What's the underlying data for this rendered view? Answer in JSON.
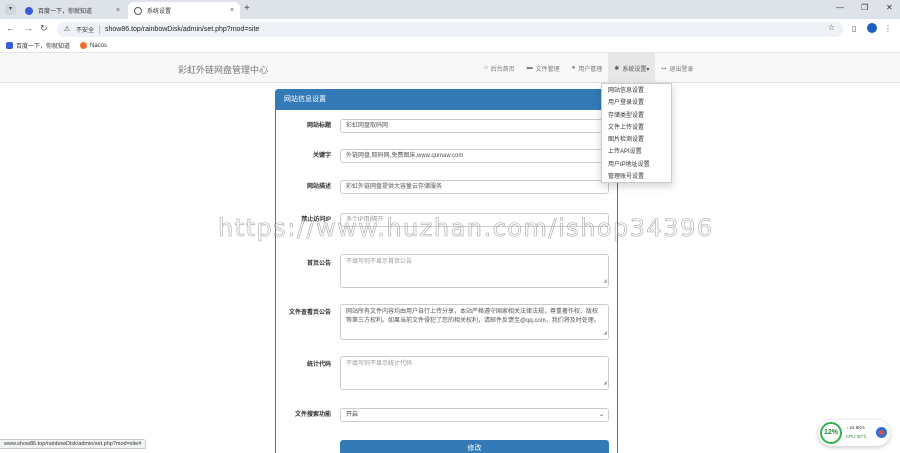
{
  "browser": {
    "tabs": [
      {
        "title": "百度一下，你就知道",
        "active": false
      },
      {
        "title": "系统设置",
        "active": true
      }
    ],
    "new_tab_glyph": "+",
    "close_glyph": "×",
    "window_controls": {
      "minimize": "—",
      "restore": "❐",
      "close": "✕"
    },
    "security_label": "不安全",
    "url": "show86.top/rainbowDisk/admin/set.php?mod=site",
    "bookmarks": [
      {
        "label": "百度一下，你就知道"
      },
      {
        "label": "Nacos"
      }
    ],
    "status_url": "www.show86.top/rainbowDisk/admin/set.php?mod=site#"
  },
  "site": {
    "brand": "彩虹外链网盘管理中心",
    "nav": [
      {
        "icon": "home-icon",
        "glyph": "⌂",
        "label": "后台首页"
      },
      {
        "icon": "folder-icon",
        "glyph": "▬",
        "label": "文件管理"
      },
      {
        "icon": "users-icon",
        "glyph": "●",
        "label": "用户管理"
      },
      {
        "icon": "gear-icon",
        "glyph": "✱",
        "label": "系统设置▾"
      },
      {
        "icon": "signout-icon",
        "glyph": "↦",
        "label": "退出登录"
      }
    ],
    "settings_menu": [
      "网站信息设置",
      "用户登录设置",
      "存储类型设置",
      "文件上传设置",
      "图片检测设置",
      "上传API设置",
      "用户IP地址设置",
      "管理账号设置"
    ]
  },
  "panel": {
    "title": "网站信息设置",
    "fields": {
      "site_title": {
        "label": "网站标题",
        "value": "彩虹网盘取码网"
      },
      "keywords": {
        "label": "关键字",
        "value": "外链网盘,取码网,免费图床,www.qumaw.com"
      },
      "description": {
        "label": "网站描述",
        "value": "彩虹外链网盘提供大容量云存储服务"
      },
      "blocked_words": {
        "label": "禁止访问IP",
        "placeholder": "多个IP用|隔开"
      },
      "announcement": {
        "label": "首页公告",
        "placeholder": "不填写则不显示首页公告"
      },
      "file_notice": {
        "label": "文件查看页公告",
        "value": "网站所有文件内容均由用户自行上传分享，本站严格遵守国家相关法律法规，尊重著作权、版权等第三方权利。如果当前文件侵犯了您的相关权利，请邮件反馈至@qq.com，我们将及时处理。"
      },
      "stats_code": {
        "label": "统计代码",
        "placeholder": "不填写则不显示统计代码"
      },
      "file_search": {
        "label": "文件搜索功能",
        "value": "开启",
        "caret": "⌄"
      }
    },
    "submit_label": "修改"
  },
  "watermark": "https://www.huzhan.com/ishop34396",
  "monitor": {
    "cpu_percent": "12%",
    "net_down": "↓ 24.8K/s",
    "net_up": "↑ 0",
    "cpu_temp": "CPU 30℃"
  },
  "colors": {
    "primary": "#337ab7",
    "tab_strip": "#dee3ea",
    "navbar_bg": "#f8f8f8",
    "monitor_ring": "#2fb34a"
  }
}
